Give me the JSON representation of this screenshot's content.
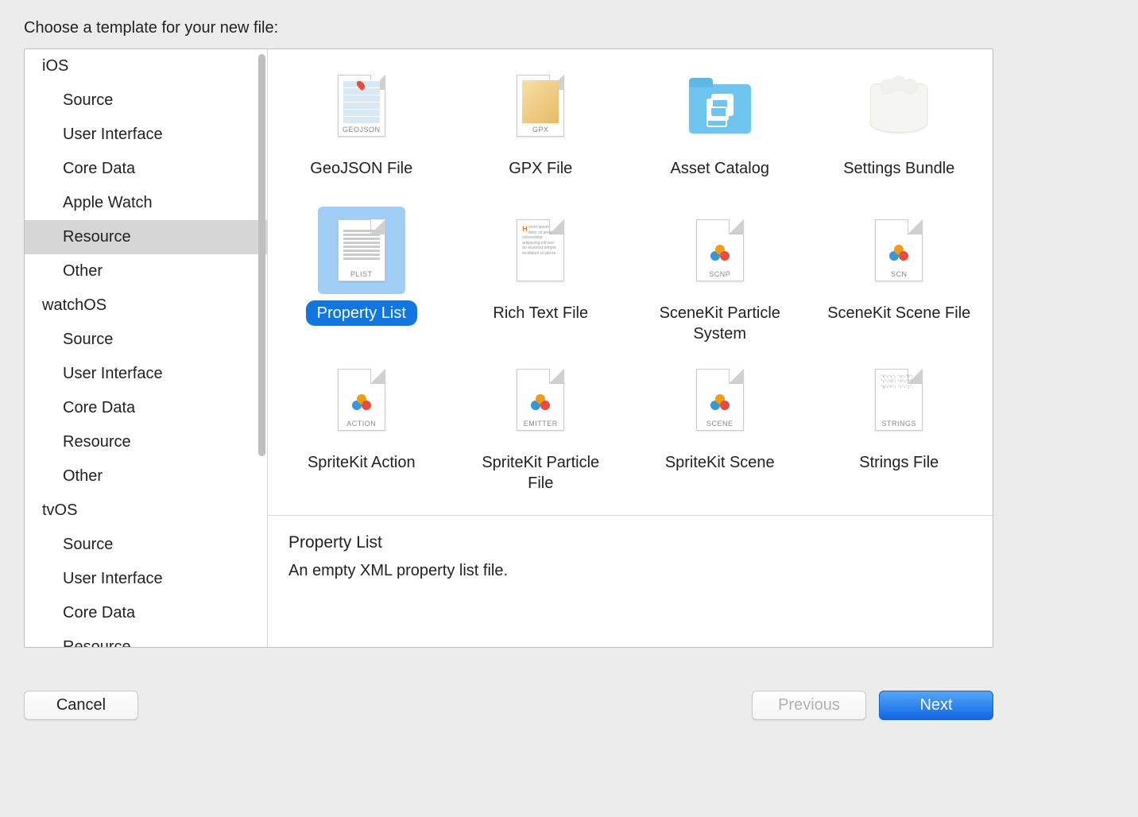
{
  "dialog_title": "Choose a template for your new file:",
  "sidebar": {
    "sections": [
      {
        "header": "iOS",
        "items": [
          "Source",
          "User Interface",
          "Core Data",
          "Apple Watch",
          "Resource",
          "Other"
        ],
        "selected_index": 4
      },
      {
        "header": "watchOS",
        "items": [
          "Source",
          "User Interface",
          "Core Data",
          "Resource",
          "Other"
        ],
        "selected_index": -1
      },
      {
        "header": "tvOS",
        "items": [
          "Source",
          "User Interface",
          "Core Data",
          "Resource"
        ],
        "selected_index": -1
      }
    ]
  },
  "templates": [
    {
      "label": "GeoJSON File",
      "icon": "geojson",
      "tag": "GEOJSON",
      "selected": false
    },
    {
      "label": "GPX File",
      "icon": "gpx",
      "tag": "GPX",
      "selected": false
    },
    {
      "label": "Asset Catalog",
      "icon": "folder",
      "tag": "",
      "selected": false
    },
    {
      "label": "Settings Bundle",
      "icon": "bundle",
      "tag": "",
      "selected": false
    },
    {
      "label": "Property List",
      "icon": "plist",
      "tag": "PLIST",
      "selected": true
    },
    {
      "label": "Rich Text File",
      "icon": "rtf",
      "tag": "",
      "selected": false
    },
    {
      "label": "SceneKit Particle System",
      "icon": "balls",
      "tag": "SCNP",
      "selected": false
    },
    {
      "label": "SceneKit Scene File",
      "icon": "balls",
      "tag": "SCN",
      "selected": false
    },
    {
      "label": "SpriteKit Action",
      "icon": "balls",
      "tag": "ACTION",
      "selected": false
    },
    {
      "label": "SpriteKit Particle File",
      "icon": "balls",
      "tag": "EMITTER",
      "selected": false
    },
    {
      "label": "SpriteKit Scene",
      "icon": "balls",
      "tag": "SCENE",
      "selected": false
    },
    {
      "label": "Strings File",
      "icon": "strings",
      "tag": "STRINGS",
      "selected": false
    }
  ],
  "detail": {
    "title": "Property List",
    "description": "An empty XML property list file."
  },
  "buttons": {
    "cancel": "Cancel",
    "previous": "Previous",
    "next": "Next"
  }
}
